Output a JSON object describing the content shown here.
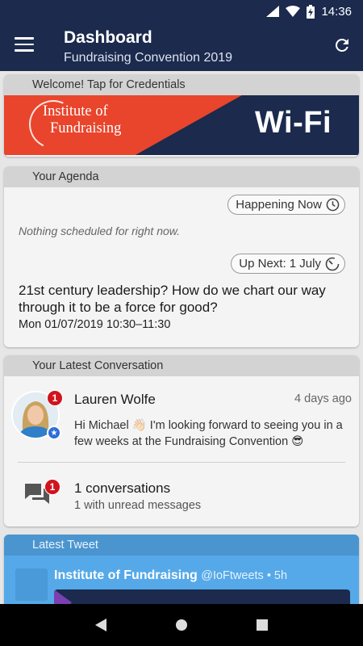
{
  "status_bar": {
    "time": "14:36"
  },
  "app_bar": {
    "title": "Dashboard",
    "subtitle": "Fundraising Convention 2019",
    "menu_icon": "hamburger-menu-icon",
    "refresh_icon": "refresh-icon"
  },
  "wifi_card": {
    "header": "Welcome! Tap for Credentials",
    "logo_line1": "Institute of",
    "logo_line2": "Fundraising",
    "banner_text": "Wi-Fi"
  },
  "agenda": {
    "header": "Your Agenda",
    "happening_now_label": "Happening Now",
    "nothing_scheduled": "Nothing scheduled for right now.",
    "up_next_label": "Up Next: 1 July",
    "session_title": "21st century leadership? How do we chart our way through it to be a force for good?",
    "session_time": "Mon 01/07/2019 10:30–11:30"
  },
  "conversation": {
    "header": "Your Latest Conversation",
    "name": "Lauren Wolfe",
    "time": "4 days ago",
    "message": "Hi Michael 👋🏻 I'm looking forward to seeing you in a few weeks at the Fundraising Convention 😎",
    "badge_count": "1",
    "summary_badge": "1",
    "summary_count": "1 conversations",
    "summary_unread": "1 with unread messages"
  },
  "tweet": {
    "header": "Latest Tweet",
    "author": "Institute of Fundraising",
    "handle": "@IoFtweets • 5h"
  },
  "colors": {
    "primary": "#1b2a4d",
    "accent_red": "#e8452c",
    "badge_red": "#d0141e",
    "twitter_blue": "#55a9e8"
  }
}
